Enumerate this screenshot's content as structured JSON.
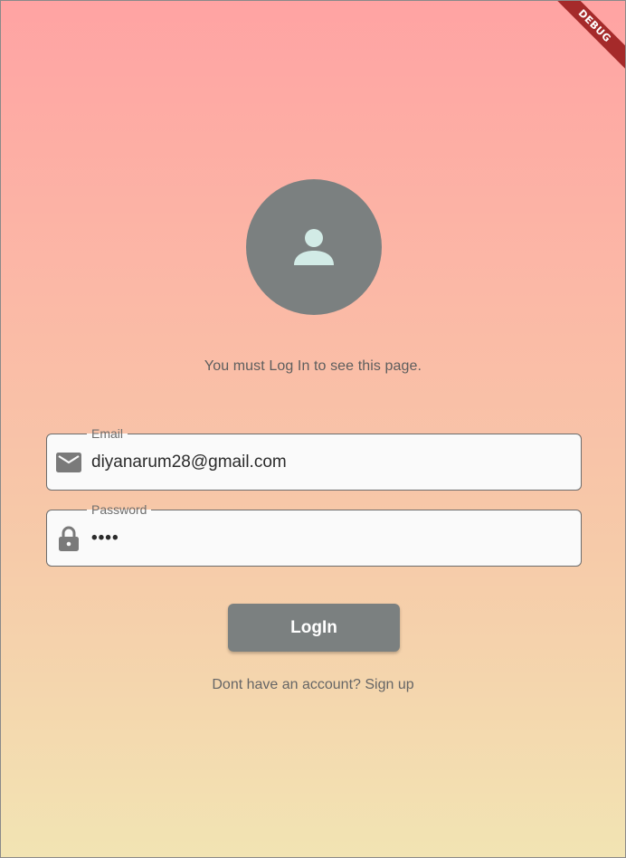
{
  "debug_banner": {
    "label": "DEBUG"
  },
  "avatar": {
    "icon": "person-icon"
  },
  "notice": {
    "text": "You must Log In to see this page."
  },
  "email_field": {
    "label": "Email",
    "value": "diyanarum28@gmail.com",
    "icon": "mail-icon"
  },
  "password_field": {
    "label": "Password",
    "masked_value": "••••",
    "icon": "lock-icon"
  },
  "login_button": {
    "label": "LogIn"
  },
  "signup": {
    "prompt": "Dont have an account?",
    "link": "Sign up"
  },
  "colors": {
    "gradient_top": "#ffa3a3",
    "gradient_bottom": "#f2e4b3",
    "avatar_bg": "#7b8080",
    "avatar_icon": "#d2ebe6",
    "button_bg": "#7b8080",
    "debug_banner": "#a52a2a"
  }
}
